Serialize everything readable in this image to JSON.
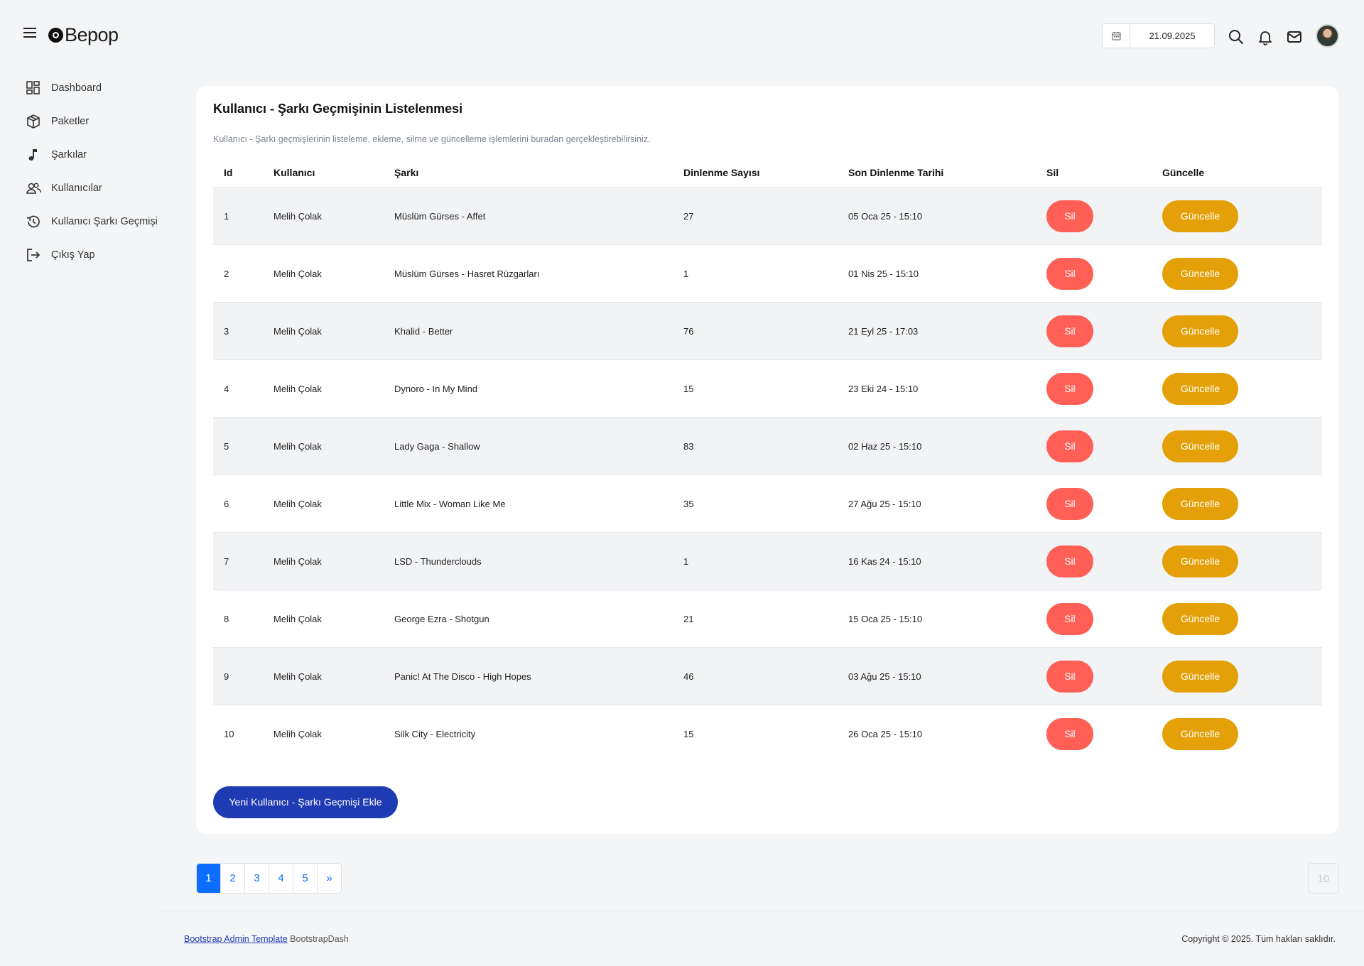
{
  "header": {
    "brand": "Bepop",
    "date": "21.09.2025"
  },
  "sidebar": {
    "items": [
      {
        "label": "Dashboard",
        "icon": "dashboard-icon"
      },
      {
        "label": "Paketler",
        "icon": "package-icon"
      },
      {
        "label": "Şarkılar",
        "icon": "music-note-icon"
      },
      {
        "label": "Kullanıcılar",
        "icon": "users-icon"
      },
      {
        "label": "Kullanıcı Şarkı Geçmişi",
        "icon": "history-icon"
      },
      {
        "label": "Çıkış Yap",
        "icon": "logout-icon"
      }
    ]
  },
  "card": {
    "title": "Kullanıcı - Şarkı Geçmişinin Listelenmesi",
    "subtitle": "Kullanıcı - Şarkı geçmişlerinin listeleme, ekleme, silme ve güncelleme işlemlerini buradan gerçekleştirebilirsiniz.",
    "columns": [
      "Id",
      "Kullanıcı",
      "Şarkı",
      "Dinlenme Sayısı",
      "Son Dinlenme Tarihi",
      "Sil",
      "Güncelle"
    ],
    "rows": [
      {
        "id": "1",
        "user": "Melih Çolak",
        "song": "Müslüm Gürses - Affet",
        "count": "27",
        "last": "05 Oca 25 - 15:10"
      },
      {
        "id": "2",
        "user": "Melih Çolak",
        "song": "Müslüm Gürses - Hasret Rüzgarları",
        "count": "1",
        "last": "01 Nis 25 - 15:10"
      },
      {
        "id": "3",
        "user": "Melih Çolak",
        "song": "Khalid - Better",
        "count": "76",
        "last": "21 Eyl 25 - 17:03"
      },
      {
        "id": "4",
        "user": "Melih Çolak",
        "song": "Dynoro - In My Mind",
        "count": "15",
        "last": "23 Eki 24 - 15:10"
      },
      {
        "id": "5",
        "user": "Melih Çolak",
        "song": "Lady Gaga - Shallow",
        "count": "83",
        "last": "02 Haz 25 - 15:10"
      },
      {
        "id": "6",
        "user": "Melih Çolak",
        "song": "Little Mix - Woman Like Me",
        "count": "35",
        "last": "27 Ağu 25 - 15:10"
      },
      {
        "id": "7",
        "user": "Melih Çolak",
        "song": "LSD - Thunderclouds",
        "count": "1",
        "last": "16 Kas 24 - 15:10"
      },
      {
        "id": "8",
        "user": "Melih Çolak",
        "song": "George Ezra - Shotgun",
        "count": "21",
        "last": "15 Oca 25 - 15:10"
      },
      {
        "id": "9",
        "user": "Melih Çolak",
        "song": "Panic! At The Disco - High Hopes",
        "count": "46",
        "last": "03 Ağu 25 - 15:10"
      },
      {
        "id": "10",
        "user": "Melih Çolak",
        "song": "Silk City - Electricity",
        "count": "15",
        "last": "26 Oca 25 - 15:10"
      }
    ],
    "delete_label": "Sil",
    "update_label": "Güncelle",
    "add_label": "Yeni Kullanıcı - Şarkı Geçmişi Ekle"
  },
  "pagination": {
    "pages": [
      "1",
      "2",
      "3",
      "4",
      "5",
      "»"
    ],
    "active": "1",
    "page_size": "10"
  },
  "footer": {
    "link": "Bootstrap Admin Template",
    "brand": "BootstrapDash",
    "copyright": "Copyright © 2025. Tüm hakları saklıdır."
  },
  "colors": {
    "delete": "#ff5f55",
    "update": "#e3a008",
    "primary": "#1f3bb3",
    "page_active": "#0d6efd"
  }
}
